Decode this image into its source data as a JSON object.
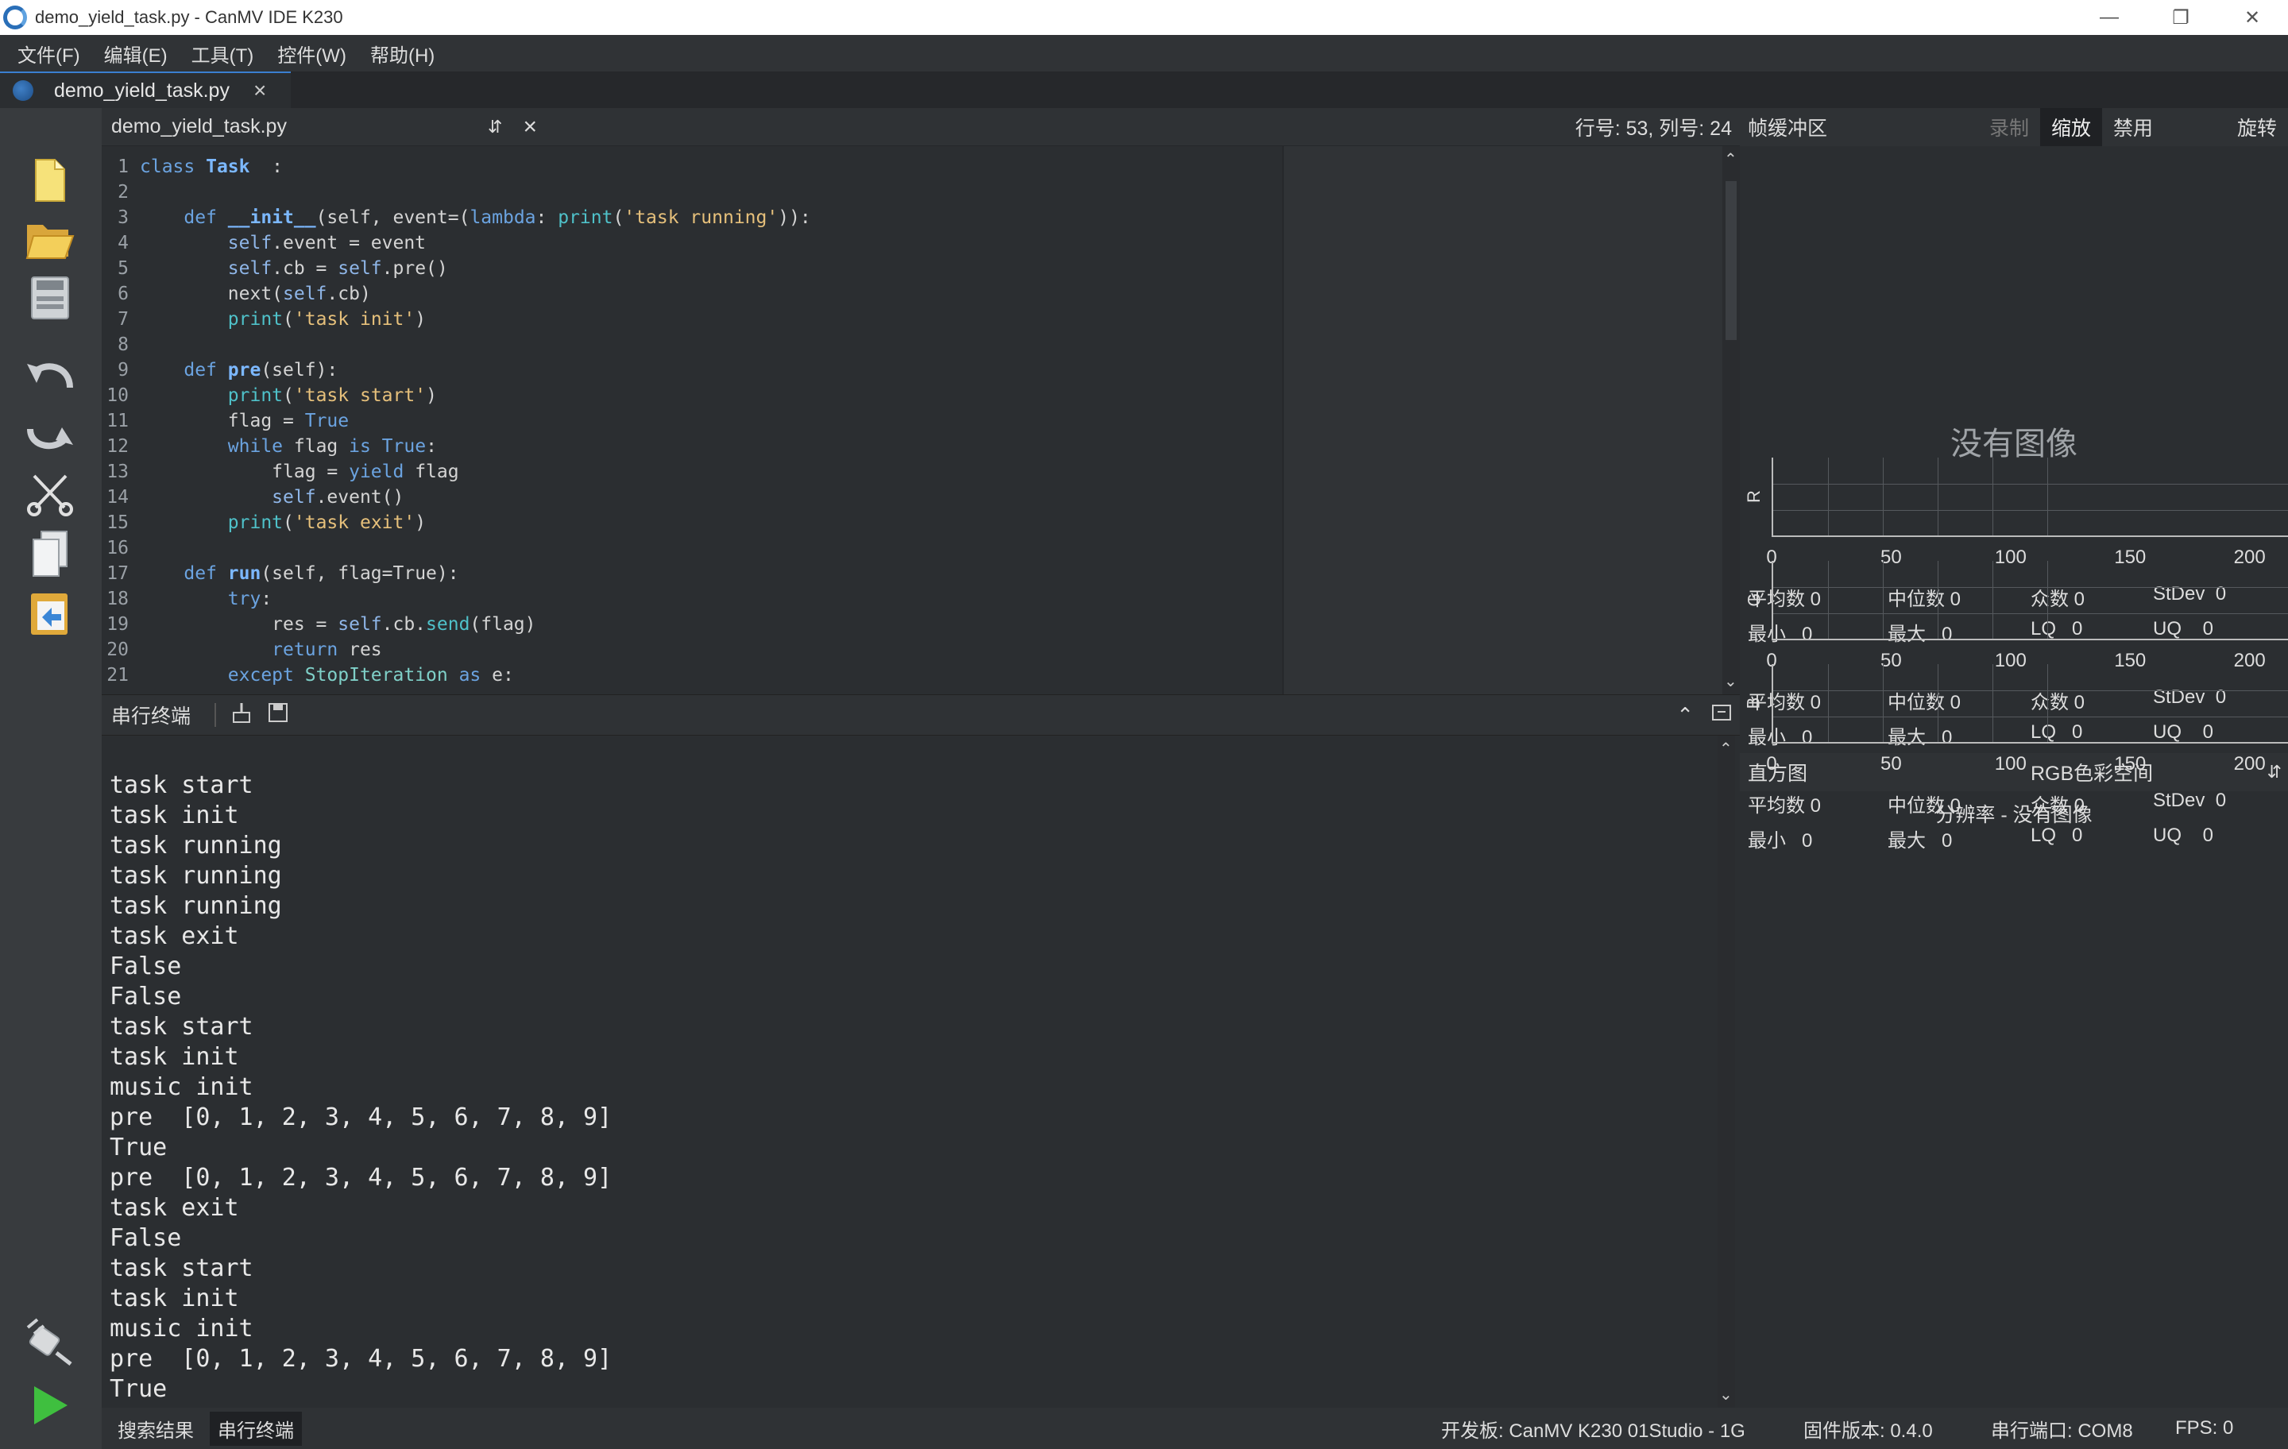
{
  "window": {
    "title": "demo_yield_task.py - CanMV IDE K230"
  },
  "menu": [
    "文件(F)",
    "编辑(E)",
    "工具(T)",
    "控件(W)",
    "帮助(H)"
  ],
  "tab": {
    "label": "demo_yield_task.py"
  },
  "editor": {
    "filename": "demo_yield_task.py",
    "position": "行号: 53, 列号: 24",
    "lines": [
      [
        [
          "kw",
          "class "
        ],
        [
          "fn",
          "Task"
        ],
        [
          "",
          "  :"
        ]
      ],
      [],
      [
        [
          "",
          "    "
        ],
        [
          "kw",
          "def "
        ],
        [
          "fn",
          "__init__"
        ],
        [
          "",
          "(self, event=("
        ],
        [
          "kw",
          "lambda"
        ],
        [
          "",
          ": "
        ],
        [
          "bi",
          "print"
        ],
        [
          "",
          "("
        ],
        [
          "str",
          "'task running'"
        ],
        [
          "",
          ")):"
        ]
      ],
      [
        [
          "",
          "        "
        ],
        [
          "slf",
          "self"
        ],
        [
          "",
          ".event = event"
        ]
      ],
      [
        [
          "",
          "        "
        ],
        [
          "slf",
          "self"
        ],
        [
          "",
          ".cb = "
        ],
        [
          "slf",
          "self"
        ],
        [
          "",
          ".pre()"
        ]
      ],
      [
        [
          "",
          "        next("
        ],
        [
          "slf",
          "self"
        ],
        [
          "",
          ".cb)"
        ]
      ],
      [
        [
          "",
          "        "
        ],
        [
          "bi",
          "print"
        ],
        [
          "",
          "("
        ],
        [
          "str",
          "'task init'"
        ],
        [
          "",
          ")"
        ]
      ],
      [],
      [
        [
          "",
          "    "
        ],
        [
          "kw",
          "def "
        ],
        [
          "fn",
          "pre"
        ],
        [
          "",
          "(self):"
        ]
      ],
      [
        [
          "",
          "        "
        ],
        [
          "bi",
          "print"
        ],
        [
          "",
          "("
        ],
        [
          "str",
          "'task start'"
        ],
        [
          "",
          ")"
        ]
      ],
      [
        [
          "",
          "        flag = "
        ],
        [
          "kw",
          "True"
        ]
      ],
      [
        [
          "",
          "        "
        ],
        [
          "kw",
          "while"
        ],
        [
          "",
          " flag "
        ],
        [
          "kw",
          "is True"
        ],
        [
          "",
          ":"
        ]
      ],
      [
        [
          "",
          "            flag = "
        ],
        [
          "kw",
          "yield"
        ],
        [
          "",
          " flag"
        ]
      ],
      [
        [
          "",
          "            "
        ],
        [
          "slf",
          "self"
        ],
        [
          "",
          ".event()"
        ]
      ],
      [
        [
          "",
          "        "
        ],
        [
          "bi",
          "print"
        ],
        [
          "",
          "("
        ],
        [
          "str",
          "'task exit'"
        ],
        [
          "",
          ")"
        ]
      ],
      [],
      [
        [
          "",
          "    "
        ],
        [
          "kw",
          "def "
        ],
        [
          "fn",
          "run"
        ],
        [
          "",
          "(self, flag=True):"
        ]
      ],
      [
        [
          "",
          "        "
        ],
        [
          "kw",
          "try"
        ],
        [
          "",
          ":"
        ]
      ],
      [
        [
          "",
          "            res = "
        ],
        [
          "slf",
          "self"
        ],
        [
          "",
          ".cb."
        ],
        [
          "bi",
          "send"
        ],
        [
          "",
          "(flag)"
        ]
      ],
      [
        [
          "",
          "            "
        ],
        [
          "kw",
          "return"
        ],
        [
          "",
          " res"
        ]
      ],
      [
        [
          "",
          "        "
        ],
        [
          "kw",
          "except "
        ],
        [
          "cl",
          "StopIteration"
        ],
        [
          "kw",
          " as"
        ],
        [
          "",
          " e:"
        ]
      ]
    ]
  },
  "terminal": {
    "title": "串行终端",
    "output": [
      "task start",
      "task init",
      "task running",
      "task running",
      "task running",
      "task exit",
      "False",
      "False",
      "task start",
      "task init",
      "music init",
      "pre  [0, 1, 2, 3, 4, 5, 6, 7, 8, 9]",
      "True",
      "pre  [0, 1, 2, 3, 4, 5, 6, 7, 8, 9]",
      "task exit",
      "False",
      "task start",
      "task init",
      "music init",
      "pre  [0, 1, 2, 3, 4, 5, 6, 7, 8, 9]",
      "True"
    ]
  },
  "framebuffer": {
    "title": "帧缓冲区",
    "record": "录制",
    "zoom": "缩放",
    "disable": "禁用",
    "rotate": "旋转",
    "no_image": "没有图像"
  },
  "histogram": {
    "title": "直方图",
    "colorspace": "RGB色彩空间",
    "resolution": "分辨率 - 没有图像",
    "ticks": [
      "0",
      "50",
      "100",
      "150",
      "200"
    ],
    "channels": [
      {
        "name": "R",
        "mean": "平均数 0",
        "median": "中位数 0",
        "mode": "众数 0",
        "stdev": "StDev  0",
        "min": "最小   0",
        "max": "最大   0",
        "lq": "LQ   0",
        "uq": "UQ    0"
      },
      {
        "name": "G",
        "mean": "平均数 0",
        "median": "中位数 0",
        "mode": "众数 0",
        "stdev": "StDev  0",
        "min": "最小   0",
        "max": "最大   0",
        "lq": "LQ   0",
        "uq": "UQ    0"
      },
      {
        "name": "B",
        "mean": "平均数 0",
        "median": "中位数 0",
        "mode": "众数 0",
        "stdev": "StDev  0",
        "min": "最小   0",
        "max": "最大   0",
        "lq": "LQ   0",
        "uq": "UQ    0"
      }
    ]
  },
  "status": {
    "tab_search": "搜索结果",
    "tab_serial": "串行终端",
    "board": "开发板: CanMV K230 01Studio - 1G",
    "firmware": "固件版本: 0.4.0",
    "port": "串行端口: COM8",
    "fps": "FPS:  0"
  }
}
